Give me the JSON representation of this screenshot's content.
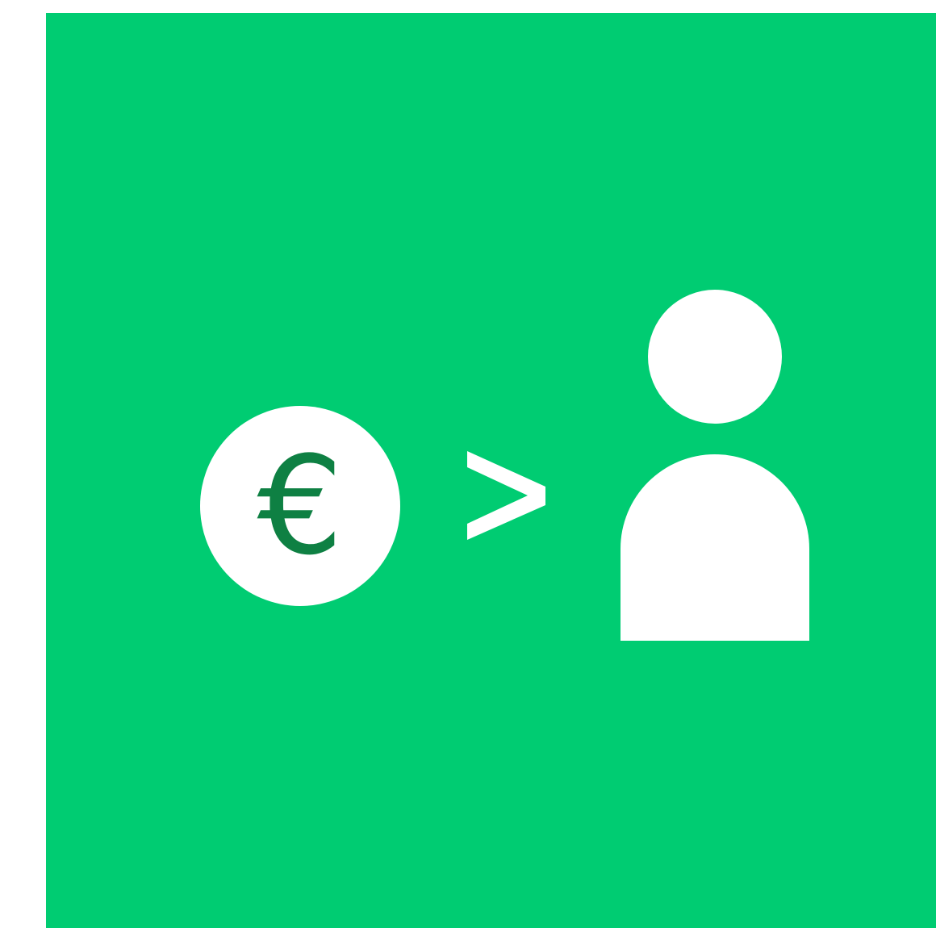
{
  "coin": {
    "symbol": "€",
    "icon": "euro-coin-icon",
    "symbol_color": "#0e8043"
  },
  "comparison": {
    "icon": "greater-than-icon"
  },
  "person": {
    "icon": "person-icon"
  },
  "colors": {
    "background": "#00cc72",
    "foreground": "#ffffff",
    "outer": "#ffffff"
  }
}
